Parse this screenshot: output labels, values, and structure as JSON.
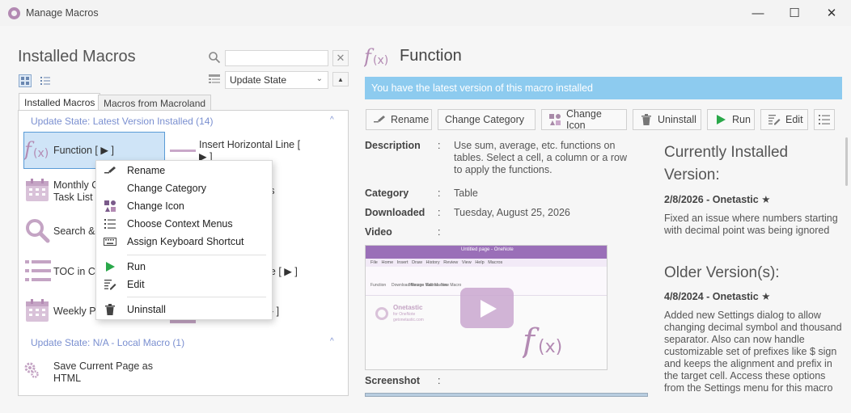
{
  "window": {
    "title": "Manage Macros",
    "minimize": "—",
    "maximize": "☐",
    "close": "✕"
  },
  "left": {
    "title": "Installed Macros",
    "search_value": "",
    "search_clear": "✕",
    "sort_value": "Update State",
    "sort_options_chevron": "⌄",
    "sort_direction": "▲",
    "tabs": [
      "Installed Macros",
      "Macros from Macroland"
    ],
    "groups": [
      {
        "label": "Update State: Latest Version Installed (14)",
        "chevron": "^"
      },
      {
        "label": "Update State: N/A - Local Macro (1)",
        "chevron": "^"
      }
    ],
    "items": [
      {
        "label": "Function [ ▶ ]",
        "icon": "function-icon"
      },
      {
        "label": "Insert Horizontal Line [ ▶ ]",
        "icon": "line-icon"
      },
      {
        "label": "Monthly C... Task List",
        "line1": "Monthly C",
        "line2": "Task List",
        "icon": "calendar-icon"
      },
      {
        "label": "...aks",
        "visible": "aks",
        "icon": ""
      },
      {
        "label": "Search &",
        "icon": "search-icon"
      },
      {
        "label": "TOC in Cu",
        "icon": "list-icon"
      },
      {
        "label": "...age [ ▶ ]",
        "visible": "age [ ▶ ]",
        "icon": ""
      },
      {
        "label": "Weekly Pl",
        "icon": "calendar-icon"
      },
      {
        "label": "...r [ ▶ ]",
        "visible": "r [ ▶ ]",
        "icon": ""
      },
      {
        "label": "Save Current Page as HTML",
        "line1": "Save Current Page as",
        "line2": "HTML",
        "icon": "gears-icon"
      }
    ]
  },
  "context_menu": {
    "items": [
      {
        "label": "Rename",
        "icon": "rename-icon"
      },
      {
        "label": "Change Category",
        "icon": ""
      },
      {
        "label": "Change Icon",
        "icon": "change-icon-icon"
      },
      {
        "label": "Choose Context Menus",
        "icon": "list-icon"
      },
      {
        "label": "Assign Keyboard Shortcut",
        "icon": "keyboard-icon"
      },
      {
        "label": "Run",
        "icon": "run-icon"
      },
      {
        "label": "Edit",
        "icon": "edit-icon"
      },
      {
        "label": "Uninstall",
        "icon": "trash-icon"
      }
    ]
  },
  "detail": {
    "icon_text": "f(x)",
    "title": "Function",
    "banner": "You have the latest version of this macro installed",
    "toolbar": [
      "Rename",
      "Change Category",
      "Change Icon",
      "Uninstall",
      "Run",
      "Edit"
    ],
    "props": {
      "description_label": "Description",
      "description_lines": [
        "Use sum, average, etc. functions on",
        "tables. Select a cell, a column or a row",
        "to apply the functions."
      ],
      "category_label": "Category",
      "category": "Table",
      "downloaded_label": "Downloaded",
      "downloaded": "Tuesday, August 25, 2026",
      "video_label": "Video",
      "screenshot_label": "Screenshot",
      "colon": ":"
    },
    "video": {
      "window_title": "Untitled page - OneNote",
      "menu": [
        "File",
        "Home",
        "Insert",
        "Draw",
        "History",
        "Review",
        "View",
        "Help",
        "Macros"
      ],
      "ribbon": [
        "Function",
        "Download Macros",
        "Manage Macros",
        "Edit Macros",
        "New Macro"
      ],
      "brand": "Onetastic",
      "brand_sub": "for OneNote",
      "brand_url": "getonetastic.com",
      "fx": "f(x)"
    },
    "side": {
      "current_heading": "Currently Installed Version:",
      "current_heading_l1": "Currently Installed",
      "current_heading_l2": "Version:",
      "current_ver": "2/8/2026 - Onetastic ★",
      "current_notes_l1": "Fixed an issue where numbers starting",
      "current_notes_l2": "with decimal point was being ignored",
      "older_heading": "Older Version(s):",
      "older_ver": "4/8/2024 - Onetastic ★",
      "older_notes": [
        "Added new Settings dialog to allow",
        "changing decimal symbol and thousand",
        "separator. Also can now handle",
        "customizable set of prefixes like $ sign",
        "and keeps the alignment and prefix in",
        "the target cell. Access these options",
        "from the Settings menu for this macro"
      ]
    }
  },
  "colors": {
    "accent": "#b38ab3",
    "banner": "#8dcbef",
    "group": "#7a8fd0",
    "selection": "#cfe4f7",
    "run": "#2aa84a"
  }
}
